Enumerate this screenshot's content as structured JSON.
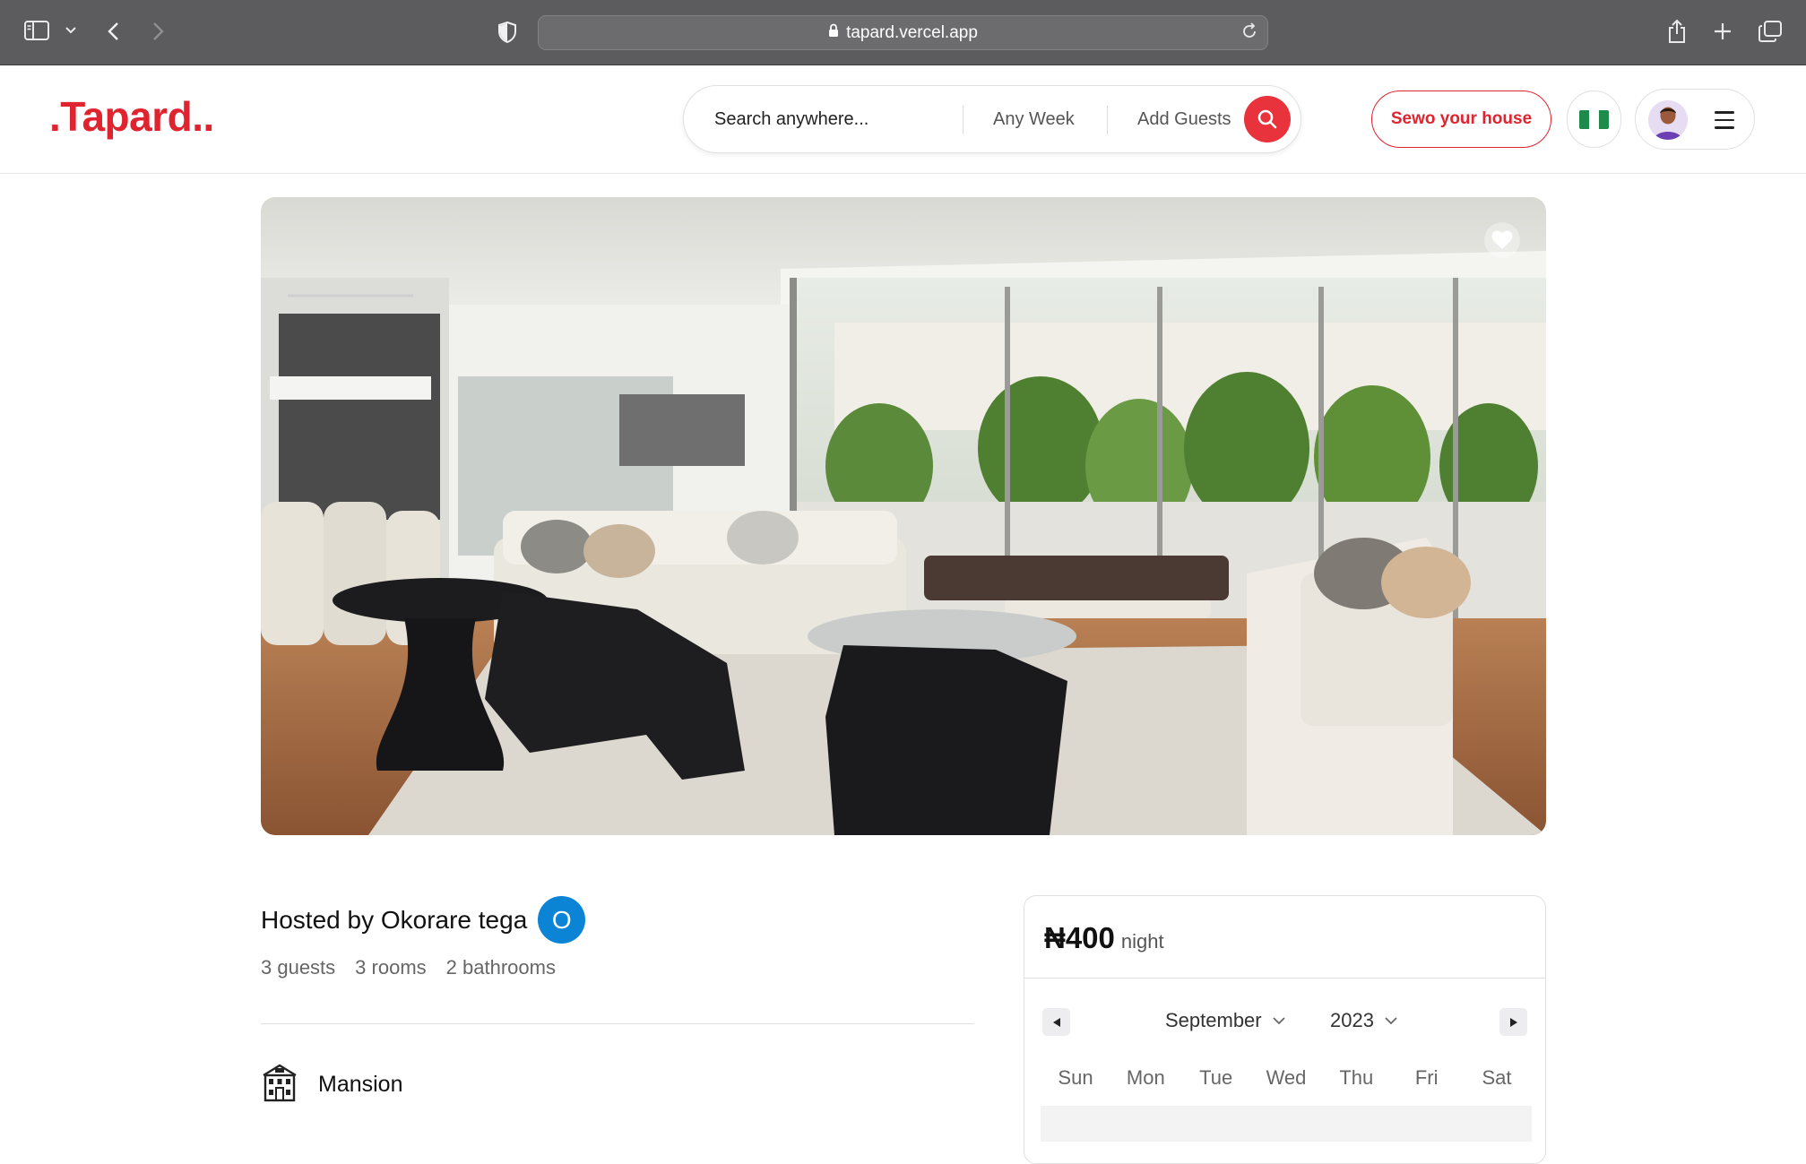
{
  "browser": {
    "url": "tapard.vercel.app",
    "icons": [
      "sidebar-icon",
      "chevron-down-icon",
      "back-icon",
      "forward-icon",
      "shield-icon",
      "lock-icon",
      "reload-icon",
      "share-icon",
      "new-tab-icon",
      "tabs-overview-icon"
    ]
  },
  "header": {
    "logo": ".Tapard..",
    "search": {
      "where": "Search anywhere...",
      "when": "Any Week",
      "who": "Add Guests"
    },
    "host_button": "Sewo your house",
    "flag": "nigeria-flag",
    "menu_icon": "hamburger-icon"
  },
  "listing": {
    "hosted_by": "Hosted by Okorare tega",
    "host_initial": "O",
    "specs": [
      "3 guests",
      "3 rooms",
      "2 bathrooms"
    ],
    "category_label": "Mansion",
    "category_icon": "mansion-icon",
    "favorite_icon": "heart-icon"
  },
  "booking": {
    "price": "₦400",
    "unit": "night",
    "month": "September",
    "year": "2023",
    "weekdays": [
      "Sun",
      "Mon",
      "Tue",
      "Wed",
      "Thu",
      "Fri",
      "Sat"
    ]
  },
  "colors": {
    "brand": "#e0242f",
    "search_button": "#e8333c",
    "host_badge": "#0b84d6",
    "browser_chrome": "#5c5c5e"
  }
}
